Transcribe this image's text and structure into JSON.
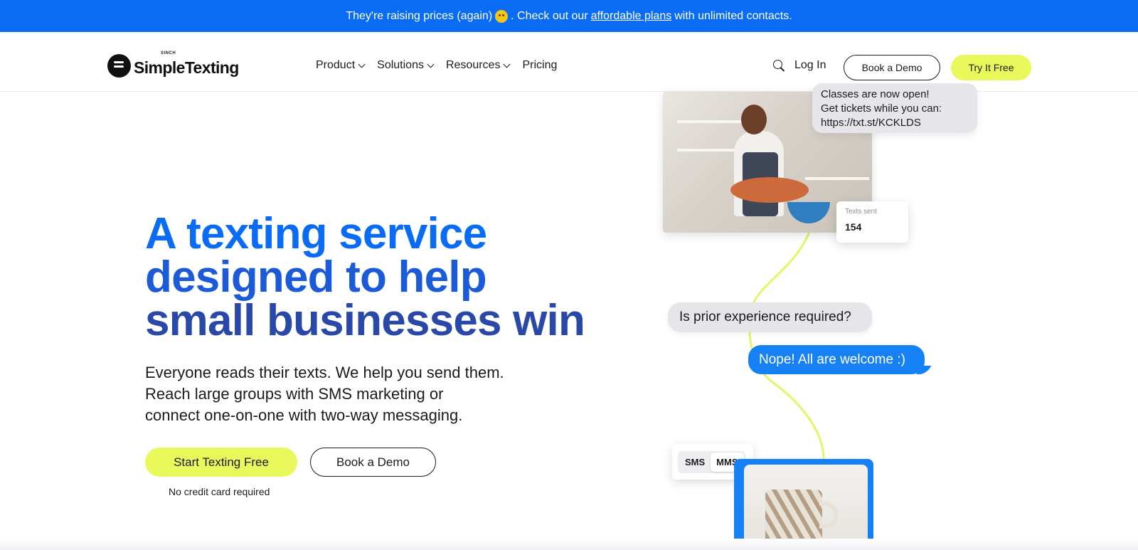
{
  "announcement": {
    "text_before": "They're raising prices (again)",
    "text_middle": ". Check out our",
    "link": "affordable plans",
    "text_after": "with unlimited contacts.",
    "emoji": "face-emoji"
  },
  "header": {
    "logo": {
      "sinch": "SINCH",
      "name": "SimpleTexting"
    },
    "nav": [
      {
        "label": "Product",
        "has_dropdown": true
      },
      {
        "label": "Solutions",
        "has_dropdown": true
      },
      {
        "label": "Resources",
        "has_dropdown": true
      },
      {
        "label": "Pricing",
        "has_dropdown": false
      }
    ],
    "login": "Log In",
    "book_demo": "Book a Demo",
    "try_free": "Try It Free"
  },
  "hero": {
    "title_lines": [
      "A texting service",
      "designed to help",
      "small businesses win"
    ],
    "subtitle_lines": [
      "Everyone reads their texts. We help you send them.",
      "Reach large groups with SMS marketing or",
      "connect one-on-one with two-way messaging."
    ],
    "cta_primary": "Start Texting Free",
    "cta_secondary": "Book a Demo",
    "note": "No credit card required"
  },
  "illustration": {
    "bubble_top_lines": [
      "Classes are now open!",
      "Get tickets while you can:",
      "https://txt.st/KCKLDS"
    ],
    "texts_sent_label": "Texts sent",
    "texts_sent_value": "154",
    "question": "Is prior experience required?",
    "answer": "Nope! All are welcome :)",
    "toggle": {
      "sms": "SMS",
      "mms": "MMS",
      "active": "MMS"
    }
  },
  "colors": {
    "brand_blue": "#0a6cf5",
    "accent_yellow": "#e9f95b",
    "bubble_blue": "#1681f5",
    "curve_yellow": "#e4f56a"
  }
}
